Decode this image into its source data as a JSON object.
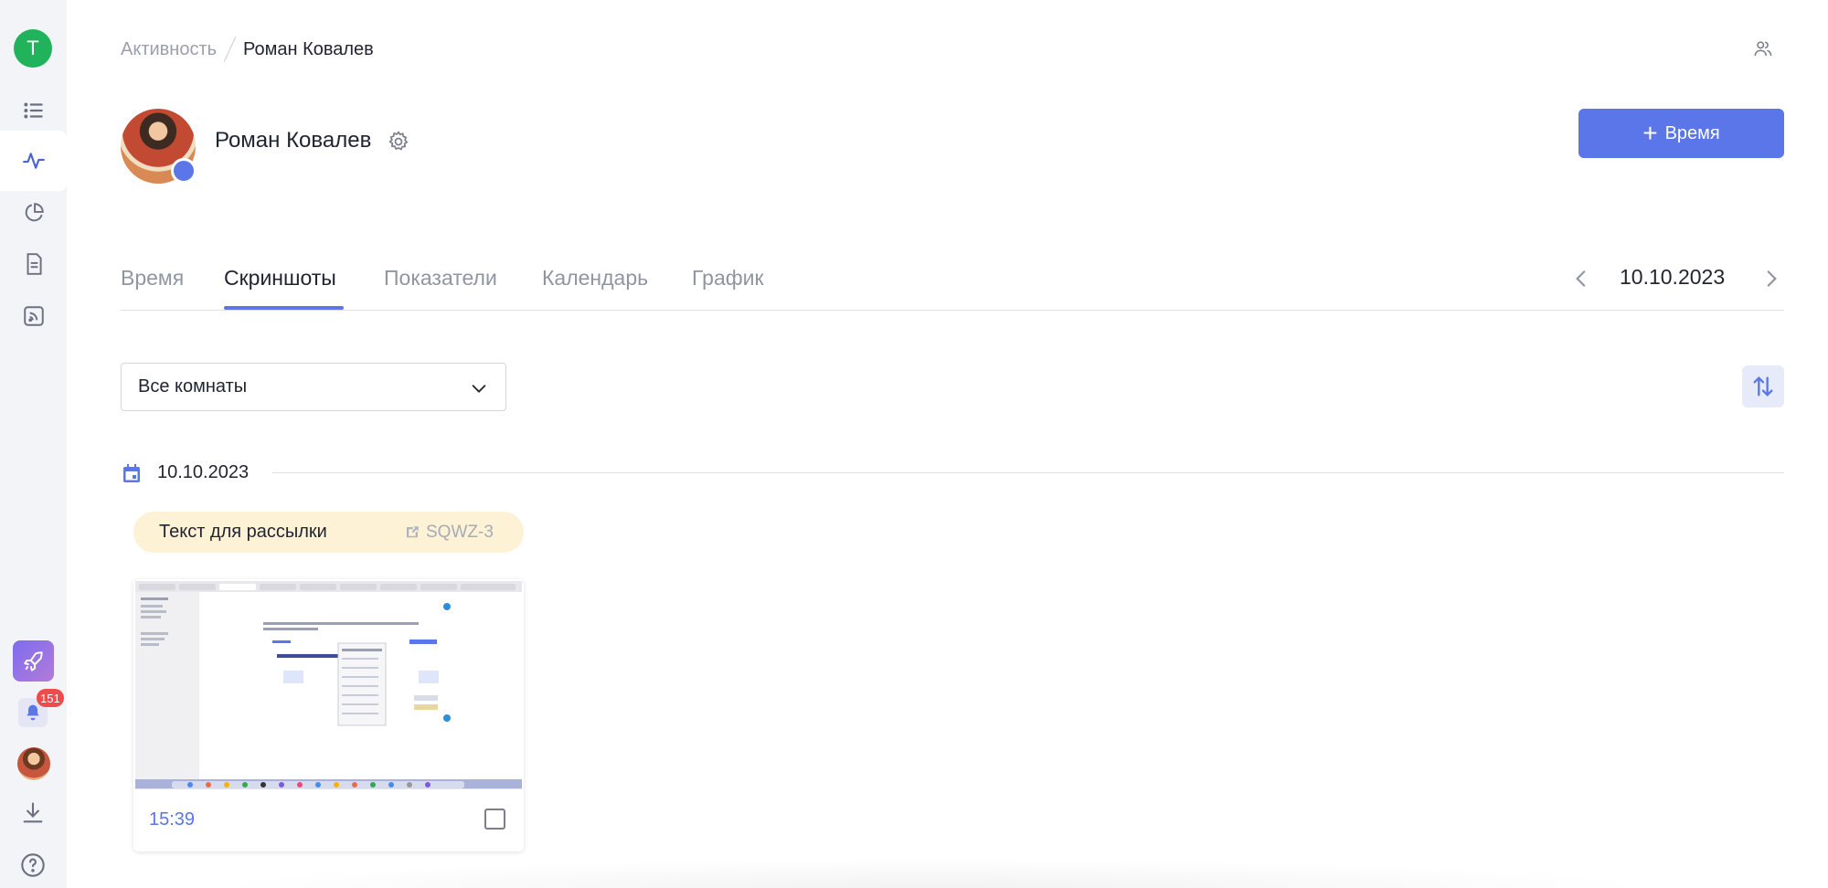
{
  "sidebar": {
    "workspace_initial": "T",
    "items": [
      {
        "icon": "list-icon"
      },
      {
        "icon": "activity-icon",
        "active": true
      },
      {
        "icon": "pie-chart-icon"
      },
      {
        "icon": "document-icon"
      },
      {
        "icon": "feed-icon"
      }
    ],
    "notifications_count": "151"
  },
  "breadcrumb": {
    "parent": "Активность",
    "current": "Роман Ковалев"
  },
  "profile": {
    "name": "Роман Ковалев"
  },
  "actions": {
    "add_time_label": "Время",
    "add_time_icon": "+"
  },
  "tabs": [
    {
      "label": "Время"
    },
    {
      "label": "Скриншоты",
      "active": true
    },
    {
      "label": "Показатели"
    },
    {
      "label": "Календарь"
    },
    {
      "label": "График"
    }
  ],
  "date_nav": {
    "value": "10.10.2023"
  },
  "filter": {
    "room_select_value": "Все комнаты"
  },
  "day_group": {
    "date": "10.10.2023",
    "task": {
      "title": "Текст для рассылки",
      "code": "SQWZ-3"
    },
    "screenshots": [
      {
        "time": "15:39",
        "checked": false
      }
    ]
  },
  "colors": {
    "accent": "#5a76e8",
    "task_pill": "#fdf1d6",
    "badge": "#ef4b4b",
    "workspace_avatar": "#21b35b"
  }
}
